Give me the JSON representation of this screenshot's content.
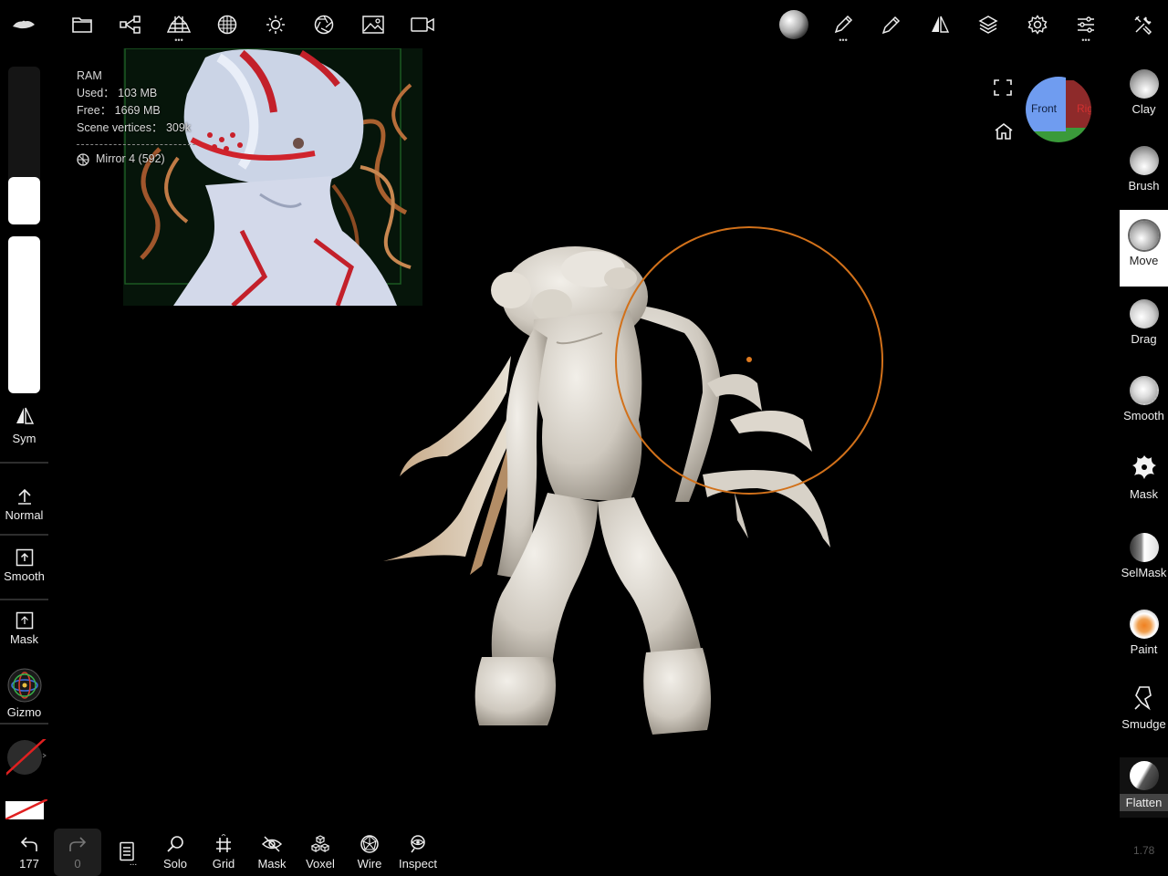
{
  "top_toolbar": {
    "left_icons": [
      "app-logo-icon",
      "folder-icon",
      "scene-share-icon",
      "topology-icon",
      "material-grid-icon",
      "light-sun-icon",
      "aperture-icon",
      "image-icon",
      "video-camera-icon"
    ],
    "right_icons": [
      "matcap-sphere-icon",
      "pen-stroke-icon",
      "picker-icon",
      "symmetry-icon",
      "layers-icon",
      "settings-gear-icon",
      "sliders-icon",
      "tools-icon"
    ]
  },
  "ram": {
    "title": "RAM",
    "used": "Used： 103 MB",
    "free": "Free： 1669 MB",
    "vertices": "Scene vertices： 309k",
    "mirror": "Mirror 4 (592)"
  },
  "left_panel": {
    "sym_label": "Sym",
    "normal_label": "Normal",
    "smooth_label": "Smooth",
    "mask_label": "Mask",
    "gizmo_label": "Gizmo",
    "radius_fraction": 0.3,
    "intensity_fraction": 1.0
  },
  "view_cube": {
    "front_label": "Front",
    "right_label": "Right"
  },
  "tools": [
    {
      "label": "Clay",
      "active": false
    },
    {
      "label": "Brush",
      "active": false
    },
    {
      "label": "Move",
      "active": true
    },
    {
      "label": "Drag",
      "active": false
    },
    {
      "label": "Smooth",
      "active": false
    },
    {
      "label": "Mask",
      "active": false
    },
    {
      "label": "SelMask",
      "active": false
    },
    {
      "label": "Paint",
      "active": false
    },
    {
      "label": "Smudge",
      "active": false
    },
    {
      "label": "Flatten",
      "active": false
    }
  ],
  "bottom_bar": {
    "undo_count": "177",
    "redo_count": "0",
    "history_dots": "...",
    "solo_label": "Solo",
    "grid_label": "Grid",
    "mask_label": "Mask",
    "voxel_label": "Voxel",
    "wire_label": "Wire",
    "inspect_label": "Inspect"
  },
  "version": "1.78",
  "colors": {
    "brush_ring": "#d2711a",
    "background": "#000000",
    "accent_orange": "#e07b20"
  }
}
